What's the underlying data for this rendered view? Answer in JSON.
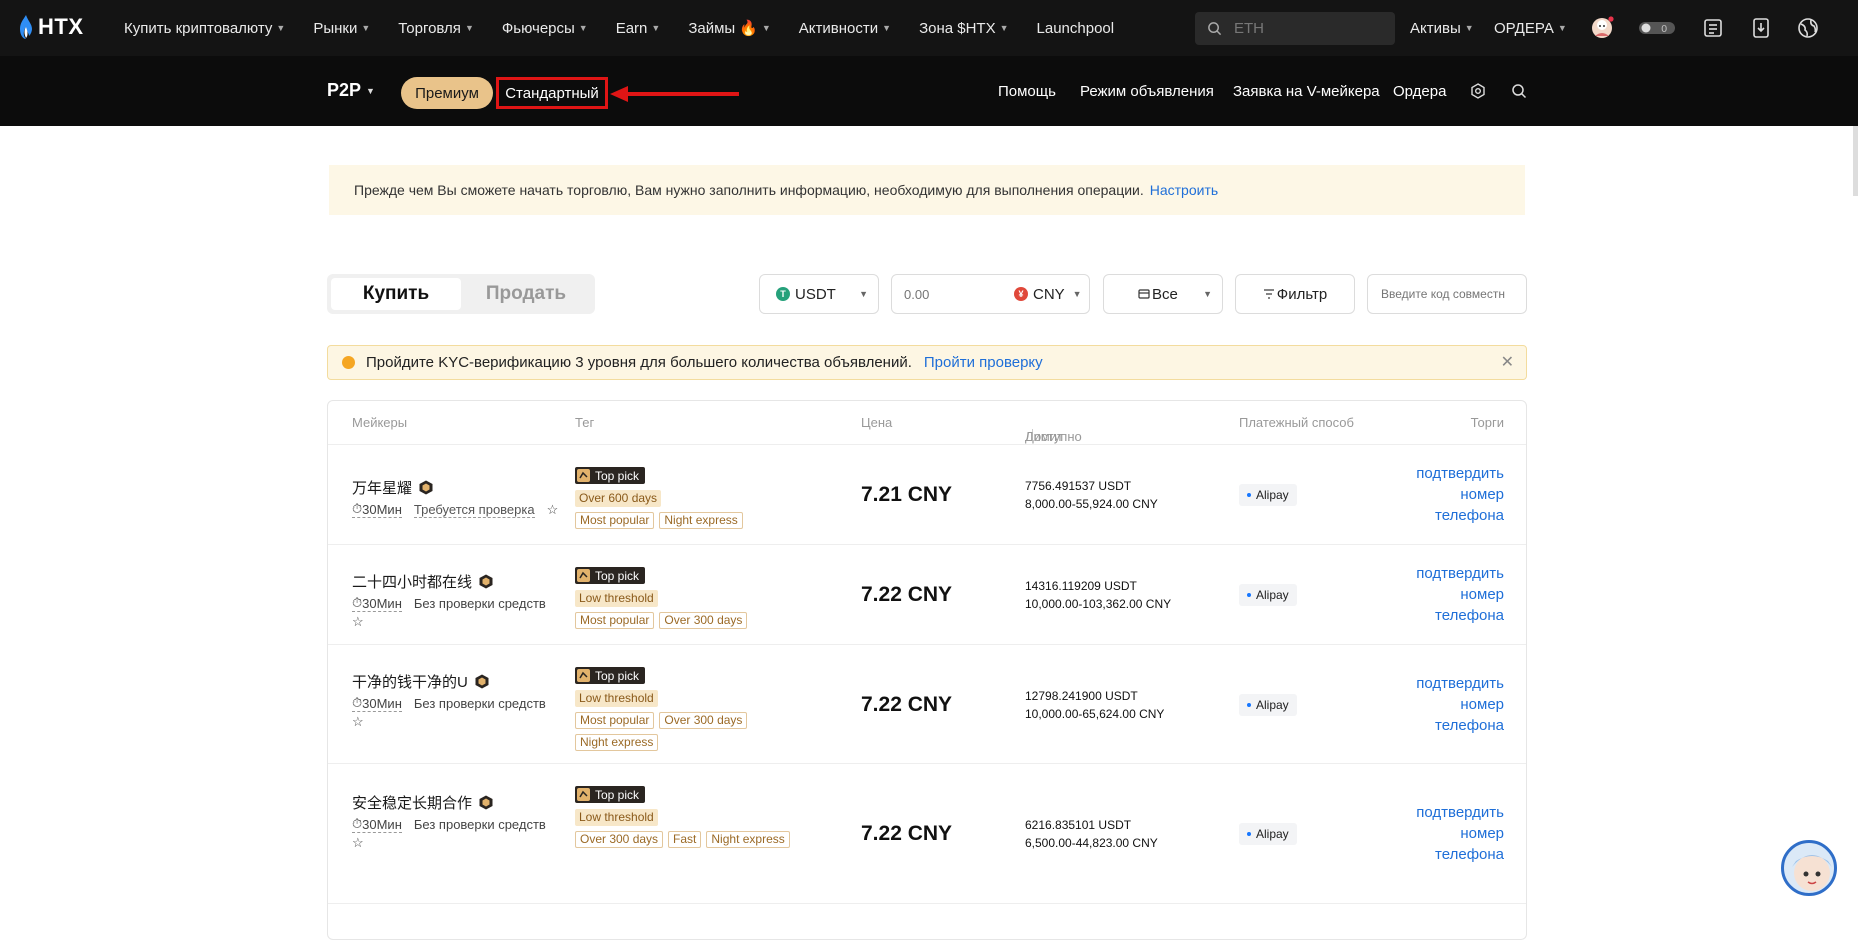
{
  "brand": {
    "name": "HTX"
  },
  "top_nav": {
    "items": [
      {
        "label": "Купить криптовалюту",
        "caret": true
      },
      {
        "label": "Рынки",
        "caret": true
      },
      {
        "label": "Торговля",
        "caret": true
      },
      {
        "label": "Фьючерсы",
        "caret": true
      },
      {
        "label": "Earn",
        "caret": true
      },
      {
        "label": "Займы",
        "caret": true,
        "icon": "fire-icon"
      },
      {
        "label": "Активности",
        "caret": true
      },
      {
        "label": "Зона $HTX",
        "caret": true
      },
      {
        "label": "Launchpool",
        "caret": false
      }
    ],
    "search_placeholder": "ETH",
    "assets_label": "Активы",
    "orders_label": "ОРДЕРА",
    "right_icons": [
      "avatar-icon",
      "toggle-icon",
      "notes-icon",
      "download-icon",
      "globe-icon"
    ]
  },
  "sub_nav": {
    "p2p_label": "P2P",
    "premium_label": "Премиум",
    "standard_label": "Стандартный",
    "links": [
      "Помощь",
      "Режим объявления",
      "Заявка на V-мейкера",
      "Ордера"
    ],
    "right_icons": [
      "settings-icon",
      "search-icon"
    ]
  },
  "notice": {
    "text": "Прежде чем Вы сможете начать торговлю, Вам нужно заполнить информацию, необходимую для выполнения операции.",
    "link": "Настроить"
  },
  "controls": {
    "buy_label": "Купить",
    "sell_label": "Продать",
    "coin": "USDT",
    "amount_placeholder": "0.00",
    "fiat": "CNY",
    "payment": "Все",
    "filter_label": "Фильтр",
    "code_placeholder": "Введите код совместн"
  },
  "kyc_banner": {
    "text": "Пройдите KYC-верификацию 3 уровня для большего количества объявлений.",
    "link": "Пройти проверку"
  },
  "table": {
    "headers": {
      "makers": "Мейкеры",
      "tag": "Тег",
      "price": "Цена",
      "available": "Доступно",
      "limit": "Лимит",
      "payment": "Платежный способ",
      "trades": "Торги"
    },
    "rows": [
      {
        "name": "万年星耀",
        "time": "30Мин",
        "verify": "Требуется проверка",
        "top_pick": "Top pick",
        "tag_lines": [
          [
            "Over 600 days"
          ],
          [
            "Most popular",
            "Night express"
          ]
        ],
        "price": "7.21 CNY",
        "available": "7756.491537 USDT",
        "limit": "8,000.00-55,924.00 CNY",
        "payment": "Alipay",
        "trade": "подтвердить номер телефона"
      },
      {
        "name": "二十四小时都在线",
        "time": "30Мин",
        "verify": "Без проверки средств",
        "top_pick": "Top pick",
        "tag_lines": [
          [
            "Low threshold"
          ],
          [
            "Most popular",
            "Over 300 days"
          ]
        ],
        "price": "7.22 CNY",
        "available": "14316.119209 USDT",
        "limit": "10,000.00-103,362.00 CNY",
        "payment": "Alipay",
        "trade": "подтвердить номер телефона"
      },
      {
        "name": "干净的钱干净的U",
        "time": "30Мин",
        "verify": "Без проверки средств",
        "top_pick": "Top pick",
        "tag_lines": [
          [
            "Low threshold"
          ],
          [
            "Most popular",
            "Over 300 days"
          ],
          [
            "Night express"
          ]
        ],
        "price": "7.22 CNY",
        "available": "12798.241900 USDT",
        "limit": "10,000.00-65,624.00 CNY",
        "payment": "Alipay",
        "trade": "подтвердить номер телефона"
      },
      {
        "name": "安全稳定长期合作",
        "time": "30Мин",
        "verify": "Без проверки средств",
        "top_pick": "Top pick",
        "tag_lines": [
          [
            "Low threshold"
          ],
          [
            "Over 300 days",
            "Fast",
            "Night express"
          ]
        ],
        "price": "7.22 CNY",
        "available": "6216.835101 USDT",
        "limit": "6,500.00-44,823.00 CNY",
        "payment": "Alipay",
        "trade": "подтвердить номер телефона"
      }
    ]
  },
  "colors": {
    "nav_bg": "#141414",
    "subnav_bg": "#0c0c0c",
    "premium_pill": "#e9c38a",
    "link": "#1f6fd8",
    "highlight_red": "#e01515"
  }
}
